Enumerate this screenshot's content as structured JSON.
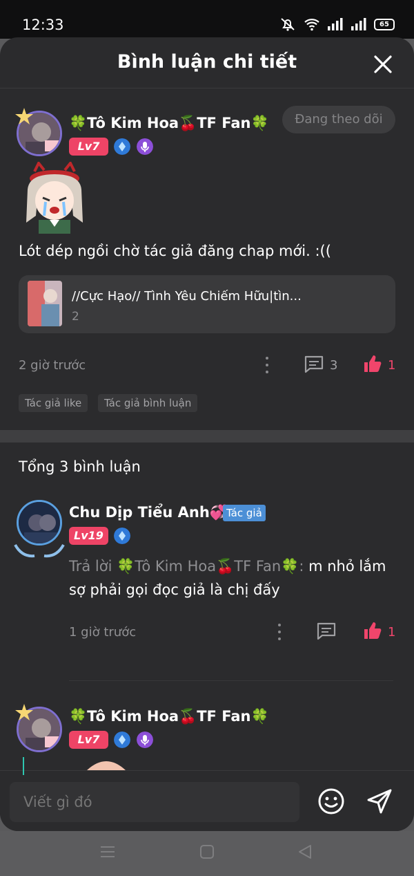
{
  "status_bar": {
    "time": "12:33",
    "battery": "65"
  },
  "header": {
    "title": "Bình luận chi tiết"
  },
  "main_comment": {
    "username": "🍀Tô Kim Hoa🍒TF Fan🍀",
    "level": "Lv7",
    "follow_label": "Đang theo dõi",
    "text": "Lót dép ngồi chờ tác giả đăng chap mới.  :((",
    "story": {
      "title": "//Cực Hạo// Tình Yêu Chiếm Hữu|tìn...",
      "subtitle": "2"
    },
    "time": "2 giờ trước",
    "comment_count": "3",
    "like_count": "1",
    "tags": [
      "Tác giả like",
      "Tác giả bình luận"
    ]
  },
  "total_label": "Tổng 3 bình luận",
  "replies": [
    {
      "username": "Chu Dịp Tiểu Anh💞",
      "author_tag": "Tác giả",
      "level": "Lv19",
      "reply_prefix": "Trả lời 🍀Tô Kim Hoa🍒TF Fan🍀:",
      "text": " m nhỏ lắm sợ phải gọi đọc giả là chị đấy",
      "time": "1 giờ trước",
      "like_count": "1"
    },
    {
      "username": "🍀Tô Kim Hoa🍒TF Fan🍀",
      "level": "Lv7"
    }
  ],
  "input": {
    "placeholder": "Viết gì đó"
  },
  "colors": {
    "accent": "#f0456b",
    "level_badge": "#ee4466",
    "author_tag": "#4c8fd6",
    "sheet_bg": "#2b2b2d"
  }
}
